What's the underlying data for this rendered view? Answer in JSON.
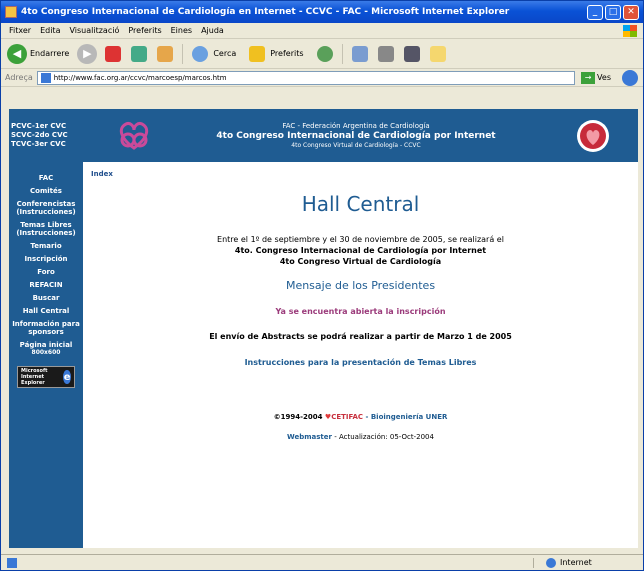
{
  "window": {
    "title": "4to Congreso Internacional de Cardiología en Internet - CCVC - FAC - Microsoft Internet Explorer",
    "min": "_",
    "max": "□",
    "close": "✕"
  },
  "menu": [
    "Fitxer",
    "Edita",
    "Visualització",
    "Preferits",
    "Eines",
    "Ajuda"
  ],
  "toolbar": {
    "back": "Endarrere",
    "search": "Cerca",
    "favorites": "Preferits"
  },
  "address": {
    "label": "Adreça",
    "url": "http://www.fac.org.ar/ccvc/marcoesp/marcos.htm",
    "go": "Ves"
  },
  "banner": {
    "left": [
      "PCVC-1er CVC",
      "SCVC-2do CVC",
      "TCVC-3er CVC"
    ],
    "line1": "FAC - Federación Argentina de Cardiología",
    "line2": "4to Congreso Internacional de Cardiología por Internet",
    "line3": "4to Congreso Virtual de Cardiología - CCVC"
  },
  "sidebar": {
    "items": [
      "FAC",
      "Comités",
      "Conferencistas (Instrucciones)",
      "Temas Libres (Instrucciones)",
      "Temario",
      "Inscripción",
      "Foro",
      "REFACIN",
      "Buscar",
      "Hall Central",
      "Información para sponsors",
      "Página inicial",
      "800x600"
    ],
    "ie_badge": "Microsoft Internet Explorer"
  },
  "main": {
    "index": "Index",
    "title": "Hall Central",
    "intro_line1": "Entre el 1º de septiembre y el 30 de noviembre de 2005, se realizará el",
    "intro_line2": "4to. Congreso Internacional de Cardiología por Internet",
    "intro_line3": "4to Congreso Virtual de Cardiología",
    "mensaje": "Mensaje de los Presidentes",
    "abierta": "Ya se encuentra abierta la inscripción",
    "abstracts": "El envío de Abstracts se podrá realizar a partir de Marzo 1 de 2005",
    "instrucciones": "Instrucciones para la presentación de Temas Libres",
    "copyright": "©1994-2004",
    "cetifac": "CETIFAC",
    "separator": " - ",
    "bioing": "Bioingeniería UNER",
    "webmaster": "Webmaster",
    "actualizacion": " - Actualización: 05-Oct-2004"
  },
  "status": {
    "zone": "Internet"
  }
}
